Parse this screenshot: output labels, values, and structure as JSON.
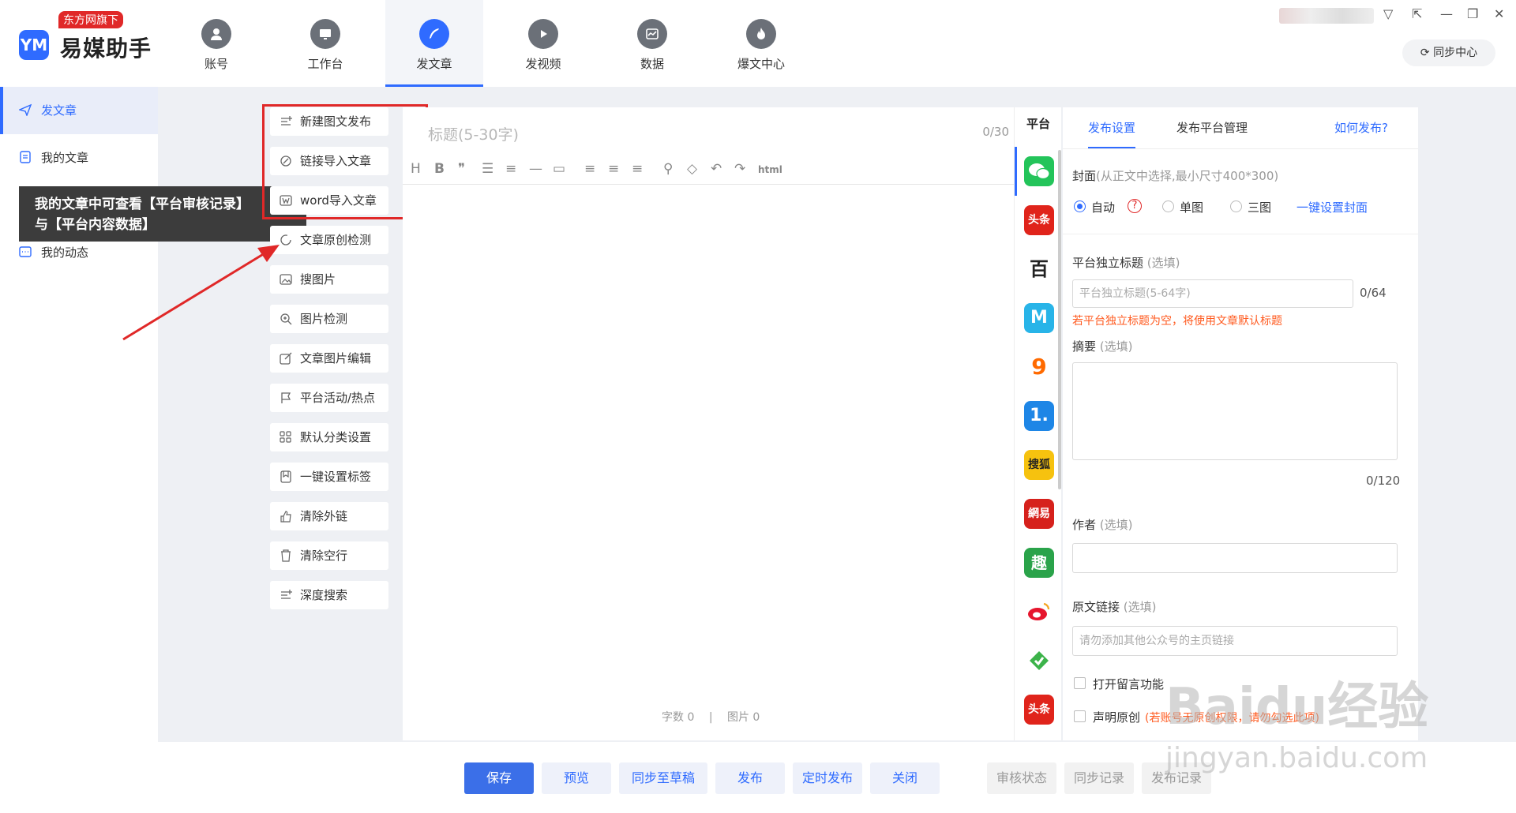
{
  "app": {
    "badge": "东方网旗下",
    "logo_mark": "YM",
    "name": "易媒助手",
    "sync_center": "同步中心"
  },
  "nav": {
    "tabs": [
      {
        "label": "账号",
        "icon": "user-icon"
      },
      {
        "label": "工作台",
        "icon": "monitor-icon"
      },
      {
        "label": "发文章",
        "icon": "feather-icon",
        "active": true
      },
      {
        "label": "发视频",
        "icon": "play-icon"
      },
      {
        "label": "数据",
        "icon": "chart-icon"
      },
      {
        "label": "爆文中心",
        "icon": "fire-icon"
      }
    ]
  },
  "sidebar": {
    "items": [
      {
        "label": "发文章",
        "active": true
      },
      {
        "label": "我的文章"
      },
      {
        "label": "我的动态"
      }
    ],
    "tooltip_line1": "我的文章中可查看【平台审核记录】",
    "tooltip_line2": "与【平台内容数据】"
  },
  "tools": [
    "新建图文发布",
    "链接导入文章",
    "word导入文章",
    "文章原创检测",
    "搜图片",
    "图片检测",
    "文章图片编辑",
    "平台活动/热点",
    "默认分类设置",
    "一键设置标签",
    "清除外链",
    "清除空行",
    "深度搜索"
  ],
  "editor": {
    "title_placeholder": "标题(5-30字)",
    "title_count": "0/30",
    "toolbar_html": "html",
    "word_count": "字数 0",
    "separator": "|",
    "image_count": "图片 0"
  },
  "platforms": {
    "header": "平台",
    "list": [
      {
        "name": "wechat",
        "text": "",
        "color": "#23c45a"
      },
      {
        "name": "toutiao",
        "text": "头条",
        "color": "#e0241b"
      },
      {
        "name": "baijiahao",
        "text": "百",
        "color": "#ffffff"
      },
      {
        "name": "dayu",
        "text": "M",
        "color": "#28b4e8"
      },
      {
        "name": "sohu-fox",
        "text": "9",
        "color": "#ffffff"
      },
      {
        "name": "yidian",
        "text": "1.",
        "color": "#1e86e6"
      },
      {
        "name": "sohu",
        "text": "搜狐",
        "color": "#f6c20f"
      },
      {
        "name": "netease",
        "text": "網易",
        "color": "#d6211c"
      },
      {
        "name": "qutoutiao",
        "text": "趣",
        "color": "#2aa34a"
      },
      {
        "name": "weibo",
        "text": "",
        "color": "#ffffff"
      },
      {
        "name": "aiqiyi",
        "text": "",
        "color": "#ffffff"
      },
      {
        "name": "toutiao2",
        "text": "头条",
        "color": "#e0241b"
      }
    ]
  },
  "settings": {
    "tabs": [
      "发布设置",
      "发布平台管理"
    ],
    "how_to": "如何发布?",
    "cover_label": "封面",
    "cover_hint": "(从正文中选择,最小尺寸400*300)",
    "cover_options": [
      "自动",
      "单图",
      "三图"
    ],
    "cover_help": "?",
    "cover_link": "一键设置封面",
    "subtitle_label": "平台独立标题",
    "optional": "(选填)",
    "subtitle_placeholder": "平台独立标题(5-64字)",
    "subtitle_count": "0/64",
    "subtitle_warn": "若平台独立标题为空，将使用文章默认标题",
    "summary_label": "摘要",
    "summary_count": "0/120",
    "author_label": "作者",
    "source_label": "原文链接",
    "source_placeholder": "请勿添加其他公众号的主页链接",
    "comment_label": "打开留言功能",
    "original_label": "声明原创",
    "original_warn": "(若账号无原创权限，请勿勾选此项)"
  },
  "actions": {
    "save": "保存",
    "preview": "预览",
    "sync_draft": "同步至草稿",
    "publish": "发布",
    "schedule": "定时发布",
    "close": "关闭",
    "review_status": "审核状态",
    "sync_record": "同步记录",
    "publish_record": "发布记录"
  },
  "watermark": {
    "line1": "Baidu经验",
    "line2": "jingyan.baidu.com"
  },
  "colors": {
    "accent": "#2f6bff",
    "highlight": "#e02828",
    "warn": "#ff5a1f"
  }
}
